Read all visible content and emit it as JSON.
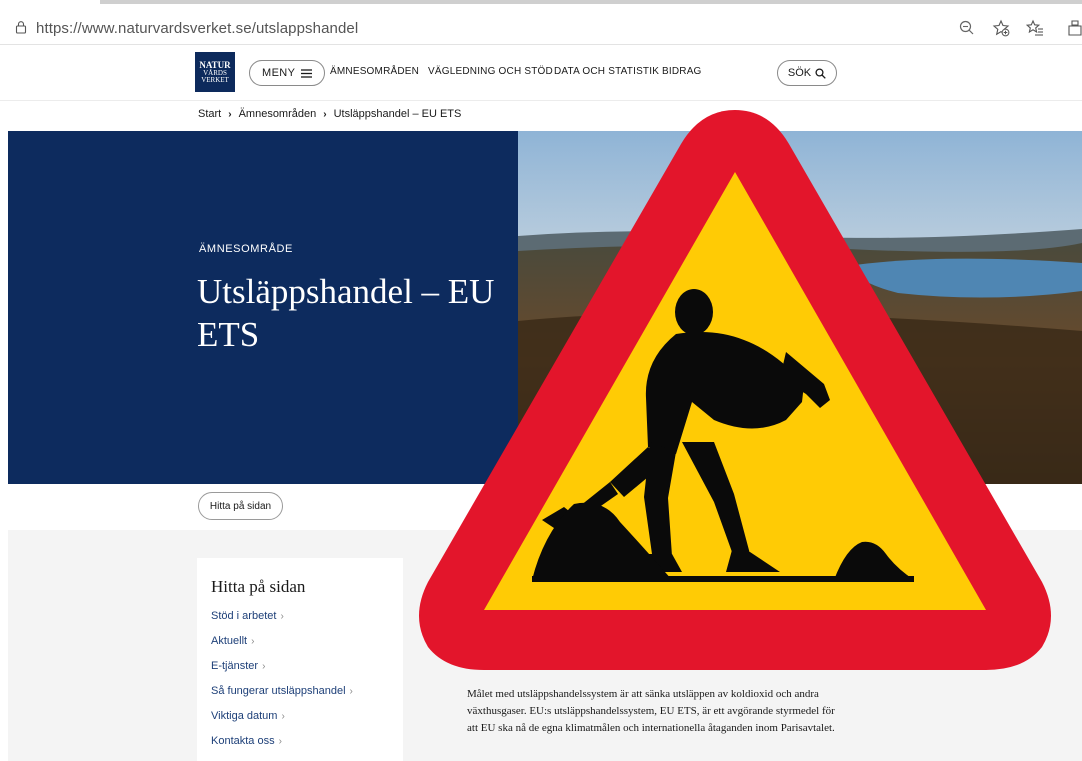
{
  "browser": {
    "url_host": "https://www.naturvardsverket.se",
    "url_path": "/utslappshandel"
  },
  "header": {
    "logo": "NATUR VÅRDS VERKET",
    "menu_label": "MENY",
    "nav": [
      "ÄMNESOMRÅDEN",
      "VÄGLEDNING OCH STÖD",
      "DATA OCH STATISTIK",
      "BIDRAG"
    ],
    "search_label": "SÖK"
  },
  "breadcrumb": [
    "Start",
    "Ämnesområden",
    "Utsläppshandel – EU ETS"
  ],
  "hero": {
    "eyebrow": "ÄMNESOMRÅDE",
    "title": "Utsläppshandel – EU ETS",
    "bg_color": "#0d2b5e"
  },
  "find_button": "Hitta på sidan",
  "toc": {
    "title": "Hitta på sidan",
    "links": [
      "Stöd i arbetet",
      "Aktuellt",
      "E-tjänster",
      "Så fungerar utsläppshandel",
      "Viktiga datum",
      "Kontakta oss"
    ]
  },
  "intro": "Målet med utsläppshandelssystem är att sänka utsläppen av koldioxid och andra växthusgaser. EU:s utsläppshandelssystem, EU ETS, är ett avgörande styrmedel för att EU ska nå de egna klimatmålen och internationella åtaganden inom Parisavtalet.",
  "overlay": {
    "icon": "roadwork-warning-sign-icon",
    "border_color": "#e3152b",
    "fill_color": "#ffcb05"
  }
}
